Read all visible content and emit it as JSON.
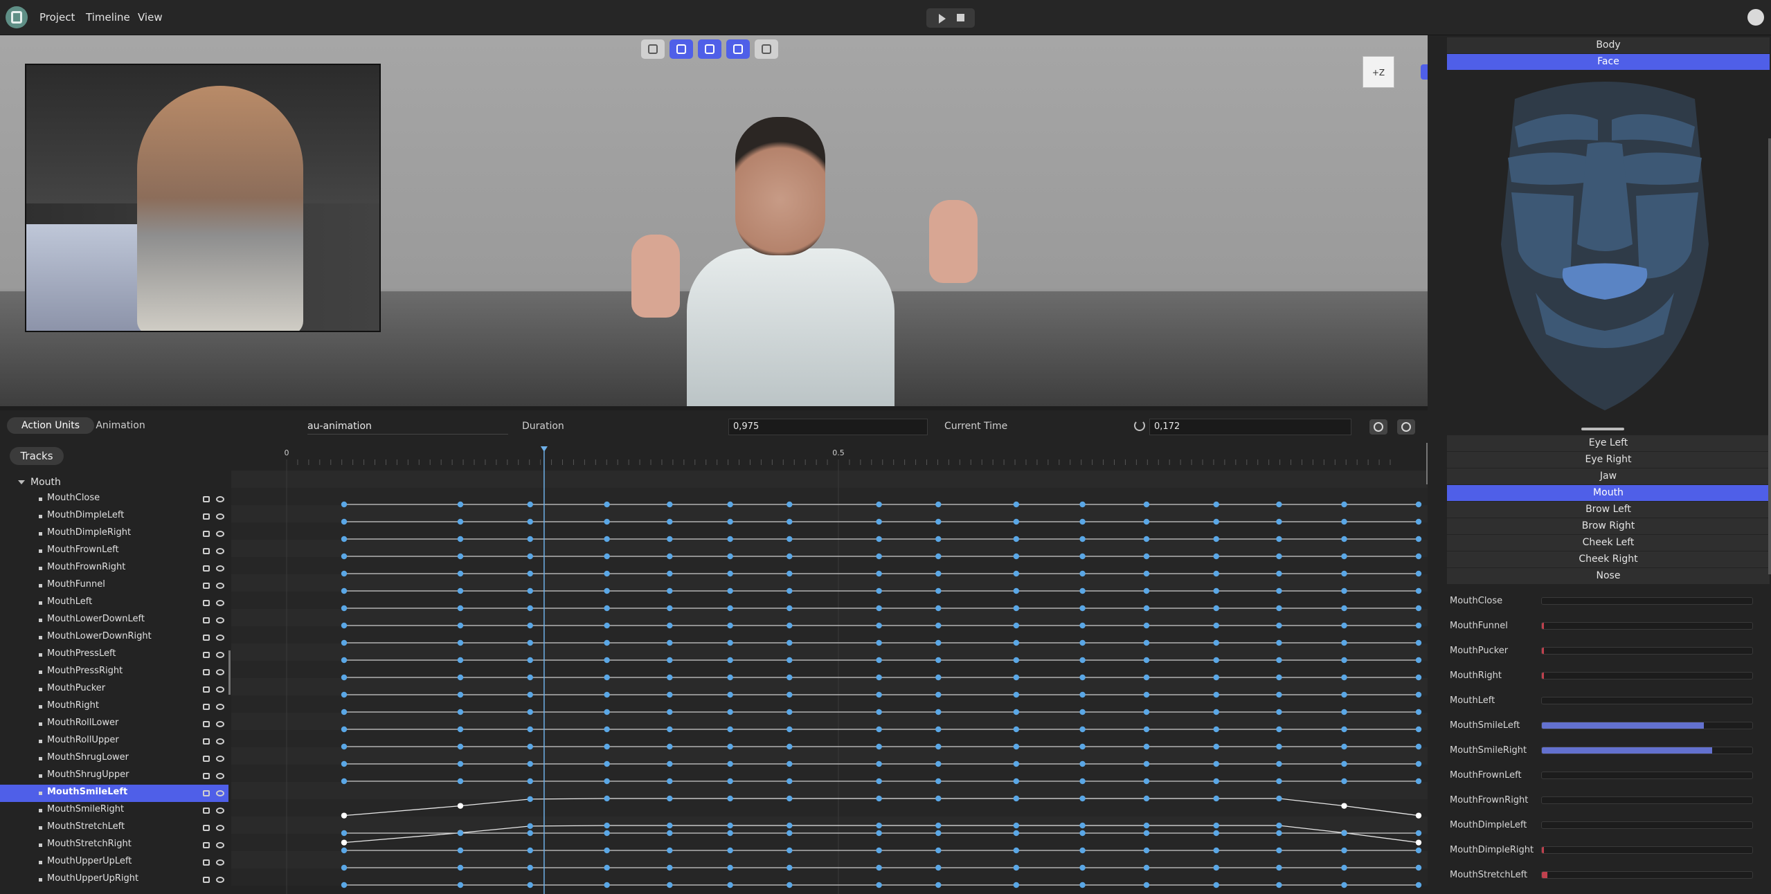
{
  "menu": {
    "project": "Project",
    "timeline": "Timeline",
    "view": "View"
  },
  "icons": {
    "logo": "hand-logo-icon",
    "play": "play-icon",
    "stop": "stop-icon",
    "github": "github-icon",
    "tools": [
      "person-icon",
      "bone-icon",
      "grid-icon",
      "navigation-icon",
      "pose-icon"
    ],
    "reset": "reset-icon",
    "filter": "filter-icon",
    "settings": "gear-icon",
    "lock": "lock-icon",
    "eye": "eye-icon",
    "collapse": "chevron-right-icon"
  },
  "colors": {
    "accent": "#4f5fe8",
    "keyframe": "#5aa7e6",
    "selected_keyframe": "#ffffff"
  },
  "viewport": {
    "axis_cube": "+Z"
  },
  "timeline": {
    "tabs": [
      "Action Units",
      "Animation"
    ],
    "animation_name": "au-animation",
    "duration_label": "Duration",
    "duration_value": "0,975",
    "current_time_label": "Current Time",
    "current_time_value": "0,172",
    "tracks_label": "Tracks",
    "ticks": [
      "0",
      "0.5"
    ],
    "group": "Mouth",
    "tracks": [
      "MouthClose",
      "MouthDimpleLeft",
      "MouthDimpleRight",
      "MouthFrownLeft",
      "MouthFrownRight",
      "MouthFunnel",
      "MouthLeft",
      "MouthLowerDownLeft",
      "MouthLowerDownRight",
      "MouthPressLeft",
      "MouthPressRight",
      "MouthPucker",
      "MouthRight",
      "MouthRollLower",
      "MouthRollUpper",
      "MouthShrugLower",
      "MouthShrugUpper",
      "MouthSmileLeft",
      "MouthSmileRight",
      "MouthStretchLeft",
      "MouthStretchRight",
      "MouthUpperUpLeft",
      "MouthUpperUpRight"
    ],
    "selected_track": "MouthSmileLeft",
    "keyframe_times": [
      0.0,
      0.1,
      0.16,
      0.226,
      0.28,
      0.332,
      0.383,
      0.46,
      0.511,
      0.578,
      0.635,
      0.69,
      0.75,
      0.804,
      0.86,
      0.924
    ],
    "smile_curve": [
      0.12,
      0.62,
      0.97,
      1,
      1,
      1,
      1,
      1,
      1,
      1,
      1,
      1,
      1,
      1,
      0.62,
      0.12
    ],
    "time_scale_end": 0.975,
    "current_time": 0.172
  },
  "right_panel": {
    "top_tabs": [
      "Body",
      "Face"
    ],
    "active_top_tab": "Face",
    "regions": [
      "Eye Left",
      "Eye Right",
      "Jaw",
      "Mouth",
      "Brow Left",
      "Brow Right",
      "Cheek Left",
      "Cheek Right",
      "Nose"
    ],
    "active_region": "Mouth",
    "action_units": [
      {
        "name": "MouthClose",
        "value": 0.0
      },
      {
        "name": "MouthFunnel",
        "value": 0.01
      },
      {
        "name": "MouthPucker",
        "value": 0.01
      },
      {
        "name": "MouthRight",
        "value": 0.01
      },
      {
        "name": "MouthLeft",
        "value": 0.0
      },
      {
        "name": "MouthSmileLeft",
        "value": 0.77
      },
      {
        "name": "MouthSmileRight",
        "value": 0.81
      },
      {
        "name": "MouthFrownLeft",
        "value": 0.0
      },
      {
        "name": "MouthFrownRight",
        "value": 0.0
      },
      {
        "name": "MouthDimpleLeft",
        "value": 0.0
      },
      {
        "name": "MouthDimpleRight",
        "value": 0.01
      },
      {
        "name": "MouthStretchLeft",
        "value": 0.025
      }
    ]
  }
}
